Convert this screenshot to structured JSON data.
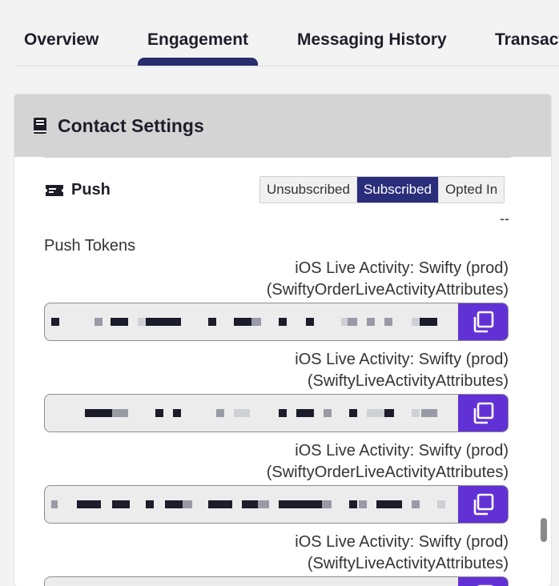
{
  "tabs": [
    "Overview",
    "Engagement",
    "Messaging History",
    "Transact"
  ],
  "card": {
    "title": "Contact Settings"
  },
  "push": {
    "label": "Push",
    "options": [
      "Unsubscribed",
      "Subscribed",
      "Opted In"
    ],
    "selected": "Subscribed",
    "status": "--"
  },
  "tokens": {
    "title": "Push Tokens",
    "items": [
      {
        "line1": "iOS Live Activity: Swifty (prod)",
        "line2": "(SwiftyOrderLiveActivityAttributes)"
      },
      {
        "line1": "iOS Live Activity: Swifty (prod)",
        "line2": "(SwiftyLiveActivityAttributes)"
      },
      {
        "line1": "iOS Live Activity: Swifty (prod)",
        "line2": "(SwiftyOrderLiveActivityAttributes)"
      },
      {
        "line1": "iOS Live Activity: Swifty (prod)",
        "line2": "(SwiftyLiveActivityAttributes)"
      }
    ]
  },
  "icons": {
    "card": "book-icon",
    "push": "push-ticket-icon",
    "copy": "copy-icon"
  },
  "colors": {
    "accent": "#6231d6",
    "selected": "#2a2d7a",
    "tab_indicator": "#2a2d6e"
  }
}
